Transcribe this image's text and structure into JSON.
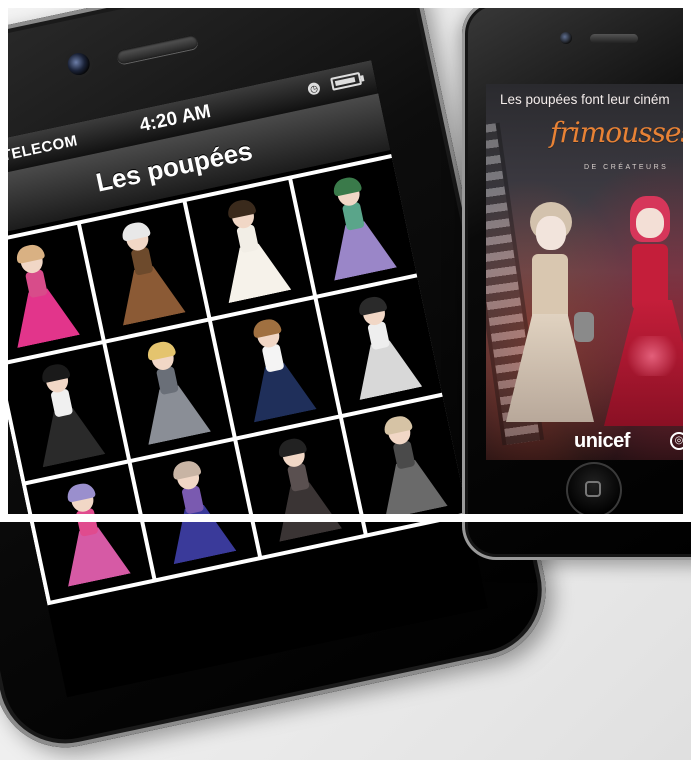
{
  "left_phone": {
    "status_bar": {
      "carrier": "AAZ TELECOM",
      "time": "4:20 AM",
      "clock_icon": "clock-icon",
      "battery_icon": "battery-icon"
    },
    "nav_title": "Les poupées",
    "dolls": [
      {
        "hair": "#d9b183",
        "body": "#d84c8a",
        "dress": "#e2358b"
      },
      {
        "hair": "#e8e8e8",
        "body": "#6d4a2c",
        "dress": "#8b5a35"
      },
      {
        "hair": "#3a2a1c",
        "body": "#f2eee6",
        "dress": "#f6f2ea"
      },
      {
        "hair": "#3a7a4a",
        "body": "#5aa58a",
        "dress": "#9a86c8"
      },
      {
        "hair": "#1a1a1a",
        "body": "#f0f0f0",
        "dress": "#2a2a2a"
      },
      {
        "hair": "#e4c46e",
        "body": "#6a6f78",
        "dress": "#8a8e96"
      },
      {
        "hair": "#a07040",
        "body": "#f4f4f4",
        "dress": "#1f2f5a"
      },
      {
        "hair": "#2a2a2a",
        "body": "#eeeeee",
        "dress": "#d8d8d8"
      },
      {
        "hair": "#9a8fcd",
        "body": "#e04b8e",
        "dress": "#d65aa5"
      },
      {
        "hair": "#c8b4a4",
        "body": "#7a5ab0",
        "dress": "#3a3a9a"
      },
      {
        "hair": "#222222",
        "body": "#5a5050",
        "dress": "#3a3434"
      },
      {
        "hair": "#d6c3a5",
        "body": "#4a4a4a",
        "dress": "#6a6a6a"
      }
    ]
  },
  "right_phone": {
    "tagline": "Les poupées font leur ciném",
    "brand_logo": "frimousses",
    "brand_subtitle": "DE CRÉATEURS",
    "partner_logo": "unicef",
    "globe_icon": "unicef-globe-icon",
    "home_icon": "home-button-icon",
    "poster_dolls": [
      {
        "hair": "#d3c2ad",
        "dress": "#d9c7b0",
        "accent": "#8a8a8a"
      },
      {
        "hair": "#d6365a",
        "dress": "#c41e3a",
        "accent": "#e35f7a"
      }
    ]
  }
}
